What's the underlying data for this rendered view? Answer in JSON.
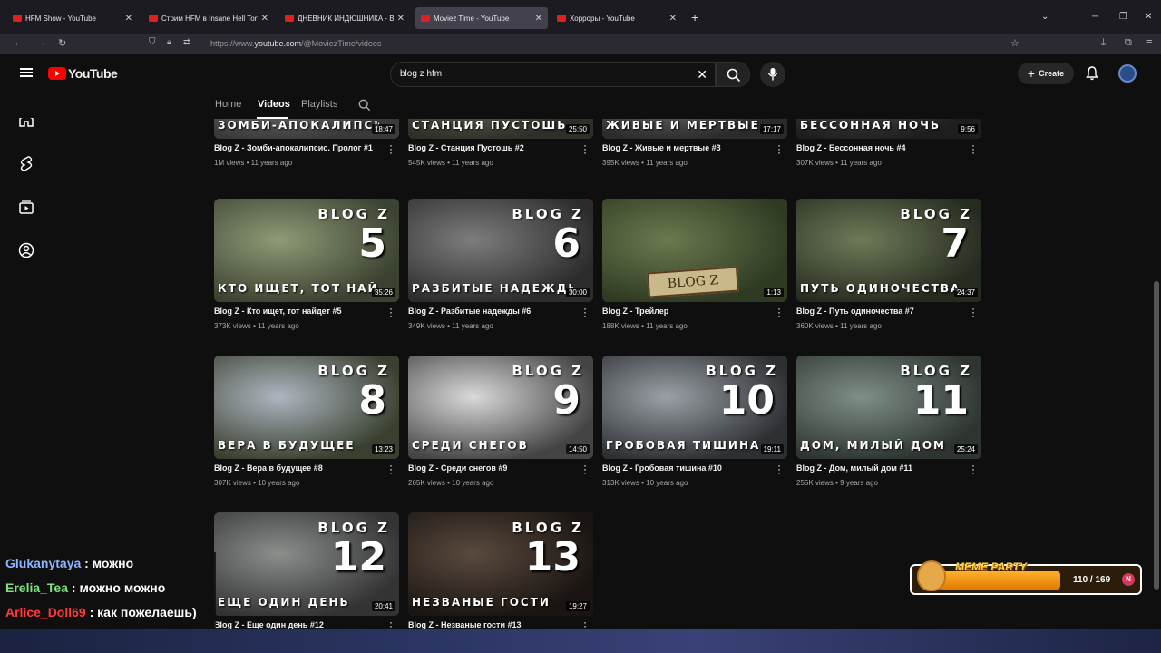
{
  "browser": {
    "tabs": [
      {
        "title": "HFM Show - YouTube",
        "active": false
      },
      {
        "title": "Стрим HFM в Insane Hell Torture",
        "active": false
      },
      {
        "title": "ДНЕВНИК ИНДЮШНИКА - ВСЕ",
        "active": false
      },
      {
        "title": "Moviez Time - YouTube",
        "active": true
      },
      {
        "title": "Хорроры - YouTube",
        "active": false
      }
    ],
    "url_prefix": "https://www.",
    "url_domain": "youtube.com",
    "url_path": "/@MoviezTime/videos"
  },
  "header": {
    "logo_text": "YouTube",
    "search_value": "blog z hfm",
    "create_label": "Create"
  },
  "channel_tabs": [
    "Home",
    "Videos",
    "Playlists"
  ],
  "videos": [
    {
      "title": "Blog Z - Зомби-апокалипсис. Пролог #1",
      "views": "1M views",
      "age": "11 years ago",
      "caption": "ЗОМБИ-АПОКАЛИПСИС",
      "number": "",
      "duration": "18:47"
    },
    {
      "title": "Blog Z - Станция Пустошь #2",
      "views": "545K views",
      "age": "11 years ago",
      "caption": "СТАНЦИЯ ПУСТОШЬ",
      "number": "",
      "duration": "25:50"
    },
    {
      "title": "Blog Z - Живые и мертвые #3",
      "views": "395K views",
      "age": "11 years ago",
      "caption": "ЖИВЫЕ И МЕРТВЫЕ",
      "number": "",
      "duration": "17:17"
    },
    {
      "title": "Blog Z - Бессонная ночь #4",
      "views": "307K views",
      "age": "11 years ago",
      "caption": "БЕССОННАЯ НОЧЬ",
      "number": "",
      "duration": "9:56"
    },
    {
      "title": "Blog Z - Кто ищет, тот найдет #5",
      "views": "373K views",
      "age": "11 years ago",
      "caption": "КТО ИЩЕТ, ТОТ НАЙДЕТ",
      "number": "5",
      "duration": "35:26"
    },
    {
      "title": "Blog Z - Разбитые надежды #6",
      "views": "349K views",
      "age": "11 years ago",
      "caption": "РАЗБИТЫЕ НАДЕЖДЫ",
      "number": "6",
      "duration": "30:00"
    },
    {
      "title": "Blog Z - Трейлер",
      "views": "188K views",
      "age": "11 years ago",
      "caption": "",
      "number": "",
      "duration": "1:13"
    },
    {
      "title": "Blog Z - Путь одиночества #7",
      "views": "360K views",
      "age": "11 years ago",
      "caption": "ПУТЬ ОДИНОЧЕСТВА",
      "number": "7",
      "duration": "24:37"
    },
    {
      "title": "Blog Z - Вера в будущее #8",
      "views": "307K views",
      "age": "10 years ago",
      "caption": "ВЕРА В БУДУЩЕЕ",
      "number": "8",
      "duration": "13:23"
    },
    {
      "title": "Blog Z - Среди снегов #9",
      "views": "265K views",
      "age": "10 years ago",
      "caption": "СРЕДИ СНЕГОВ",
      "number": "9",
      "duration": "14:50"
    },
    {
      "title": "Blog Z - Гробовая тишина #10",
      "views": "313K views",
      "age": "10 years ago",
      "caption": "ГРОБОВАЯ ТИШИНА",
      "number": "10",
      "duration": "19:11"
    },
    {
      "title": "Blog Z - Дом, милый дом #11",
      "views": "255K views",
      "age": "9 years ago",
      "caption": "ДОМ, МИЛЫЙ ДОМ",
      "number": "11",
      "duration": "25:24"
    },
    {
      "title": "Blog Z - Еще один день #12",
      "views": "",
      "age": "",
      "caption": "ЕЩЕ ОДИН ДЕНЬ",
      "number": "12",
      "duration": "20:41"
    },
    {
      "title": "Blog Z - Незваные гости #13",
      "views": "",
      "age": "",
      "caption": "НЕЗВАНЫЕ ГОСТИ",
      "number": "13",
      "duration": "19:27"
    }
  ],
  "thumb_brand": "BLOG Z",
  "trailer_logo": "BLOG Z",
  "chat": [
    {
      "user": "Glukanytaya",
      "text": "можно",
      "color": "#8fb4ff"
    },
    {
      "user": "Erelia_Tea",
      "text": "можно можно",
      "color": "#7fe07f"
    },
    {
      "user": "Arlice_Doll69",
      "text": "как пожелаешь)",
      "color": "#ff3b3b"
    }
  ],
  "meme_party": {
    "label": "MEME PARTY",
    "count": "110 / 169",
    "coin": "N",
    "progress": 0.65
  },
  "colors": {
    "accent": "#ff0000",
    "background": "#0f0f0f"
  }
}
